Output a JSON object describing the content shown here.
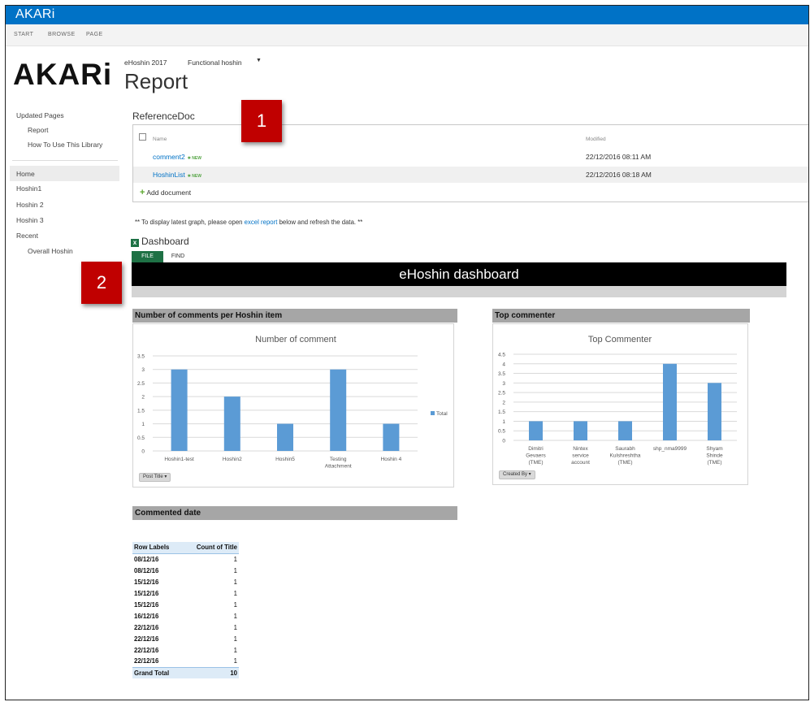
{
  "suite": {
    "brand": "AKARi"
  },
  "ribbon": {
    "tabs": [
      "START",
      "BROWSE",
      "PAGE"
    ]
  },
  "logo": "AKARi",
  "topnav": {
    "items": [
      "eHoshin 2017",
      "Functional hoshin"
    ],
    "dropdown_icon": "caret-down-icon"
  },
  "page_title": "Report",
  "quicklaunch": {
    "group1": {
      "title": "Updated Pages",
      "items": [
        "Report",
        "How To Use This Library"
      ]
    },
    "items": [
      "Home",
      "Hoshin1",
      "Hoshin 2",
      "Hoshin 3",
      "Recent"
    ],
    "recent_items": [
      "Overall Hoshin"
    ]
  },
  "reference_doc": {
    "title": "ReferenceDoc",
    "columns": [
      "Name",
      "Modified"
    ],
    "new_tag": "NEW",
    "rows": [
      {
        "name": "comment2",
        "modified": "22/12/2016 08:11 AM"
      },
      {
        "name": "HoshinList",
        "modified": "22/12/2016 08:18 AM"
      }
    ],
    "add_label": "Add document"
  },
  "badges": [
    "1",
    "2"
  ],
  "note": {
    "prefix": "** To display latest graph, please open ",
    "link": "excel report",
    "suffix": " below and refresh the data. **"
  },
  "dashboard": {
    "title": "Dashboard",
    "tabs": [
      "FILE",
      "FIND"
    ],
    "banner": "eHoshin dashboard"
  },
  "panels": {
    "comments_header": "Number of comments per Hoshin item",
    "commenter_header": "Top commenter",
    "date_header": "Commented date"
  },
  "slicers": {
    "chart1": "Post Title",
    "chart2": "Created By"
  },
  "colors": {
    "bar": "#5b9bd5",
    "suite": "#0072c6",
    "badge": "#c00000",
    "excel": "#1e7145"
  },
  "chart_data": [
    {
      "type": "bar",
      "title": "Number of comment",
      "categories": [
        "Hoshin1-test",
        "Hoshin2",
        "Hoshin5",
        "Testing Attachment",
        "Hoshin 4"
      ],
      "series": [
        {
          "name": "Total",
          "values": [
            3,
            2,
            1,
            3,
            1
          ]
        }
      ],
      "ylim": [
        0,
        3.5
      ],
      "yticks": [
        "0",
        "0.5",
        "1",
        "1.5",
        "2",
        "2.5",
        "3",
        "3.5"
      ],
      "grid": true,
      "legend": "right"
    },
    {
      "type": "bar",
      "title": "Top Commenter",
      "categories": [
        "Dimitri Gevaers (TME)",
        "Nintex service account",
        "Saurabh Kulshreshtha (TME)",
        "shp_nma9999",
        "Shyam Shinde (TME)"
      ],
      "series": [
        {
          "values": [
            1,
            1,
            1,
            4,
            3
          ]
        }
      ],
      "ylim": [
        0,
        4.5
      ],
      "yticks": [
        "0",
        "0.5",
        "1",
        "1.5",
        "2",
        "2.5",
        "3",
        "3.5",
        "4",
        "4.5"
      ],
      "grid": true,
      "legend": "none"
    }
  ],
  "pivot": {
    "headers": [
      "Row Labels",
      "Count of Title"
    ],
    "rows": [
      [
        "08/12/16",
        "1"
      ],
      [
        "08/12/16",
        "1"
      ],
      [
        "15/12/16",
        "1"
      ],
      [
        "15/12/16",
        "1"
      ],
      [
        "15/12/16",
        "1"
      ],
      [
        "16/12/16",
        "1"
      ],
      [
        "22/12/16",
        "1"
      ],
      [
        "22/12/16",
        "1"
      ],
      [
        "22/12/16",
        "1"
      ],
      [
        "22/12/16",
        "1"
      ]
    ],
    "total": [
      "Grand Total",
      "10"
    ]
  }
}
